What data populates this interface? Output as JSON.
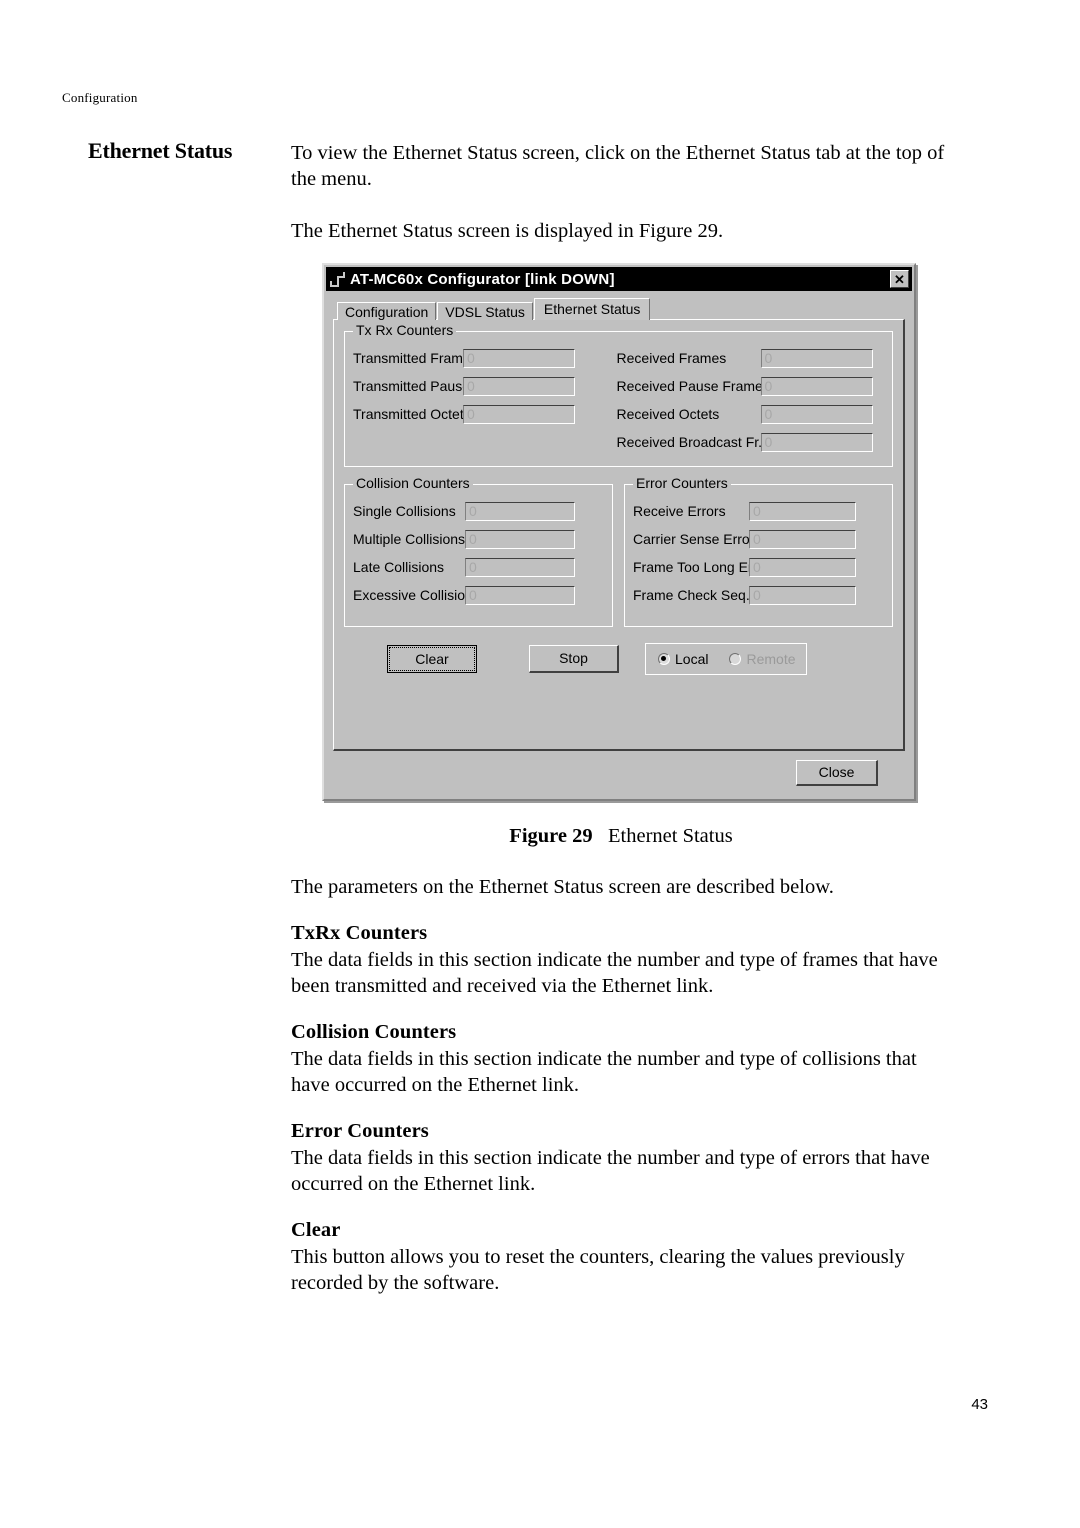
{
  "page": {
    "running_head": "Configuration",
    "page_number": "43",
    "margin_heading": "Ethernet Status"
  },
  "intro": {
    "para1": "To view the Ethernet Status screen, click on the Ethernet Status tab at the top of the menu.",
    "para2": "The Ethernet Status screen is displayed in Figure 29."
  },
  "figure": {
    "caption_label": "Figure 29",
    "caption_text": "Ethernet Status"
  },
  "dialog": {
    "title": "AT-MC60x Configurator  [link DOWN]",
    "close_icon": "✕",
    "tabs": [
      {
        "label": "Configuration",
        "active": false
      },
      {
        "label": "VDSL Status",
        "active": false
      },
      {
        "label": "Ethernet Status",
        "active": true
      }
    ],
    "groups": {
      "txrx": {
        "legend": "Tx Rx Counters",
        "left_fields": [
          {
            "label": "Transmitted Frames",
            "value": "0"
          },
          {
            "label": "Transmitted Pause Fr.",
            "value": "0"
          },
          {
            "label": "Transmitted Octets",
            "value": "0"
          }
        ],
        "right_fields": [
          {
            "label": "Received Frames",
            "value": "0"
          },
          {
            "label": "Received Pause Frames",
            "value": "0"
          },
          {
            "label": "Received Octets",
            "value": "0"
          },
          {
            "label": "Received Broadcast Fr.",
            "value": "0"
          }
        ]
      },
      "collision": {
        "legend": "Collision Counters",
        "fields": [
          {
            "label": "Single Collisions",
            "value": "0"
          },
          {
            "label": "Multiple Collisions",
            "value": "0"
          },
          {
            "label": "Late Collisions",
            "value": "0"
          },
          {
            "label": "Excessive Collisions",
            "value": "0"
          }
        ]
      },
      "error": {
        "legend": "Error Counters",
        "fields": [
          {
            "label": "Receive Errors",
            "value": "0"
          },
          {
            "label": "Carrier Sense Errors",
            "value": "0"
          },
          {
            "label": "Frame Too Long Errors",
            "value": "0"
          },
          {
            "label": "Frame Check Seq. Er.",
            "value": "0"
          }
        ]
      }
    },
    "buttons": {
      "clear": "Clear",
      "stop": "Stop",
      "close": "Close"
    },
    "radios": [
      {
        "label": "Local",
        "selected": true,
        "disabled": false
      },
      {
        "label": "Remote",
        "selected": false,
        "disabled": true
      }
    ]
  },
  "sections": [
    {
      "intro": "The parameters on the Ethernet Status screen are described below."
    },
    {
      "heading": "TxRx Counters",
      "body": "The data fields in this section indicate the number and type of frames that have been transmitted and received via the Ethernet link."
    },
    {
      "heading": "Collision Counters",
      "body": "The data fields in this section indicate the number and type of collisions that have occurred on the Ethernet link."
    },
    {
      "heading": "Error Counters",
      "body": "The data fields in this section indicate the number and type of errors that have occurred on the Ethernet link."
    },
    {
      "heading": "Clear",
      "body": "This button allows you to reset the counters, clearing the values previously recorded by the software."
    }
  ]
}
